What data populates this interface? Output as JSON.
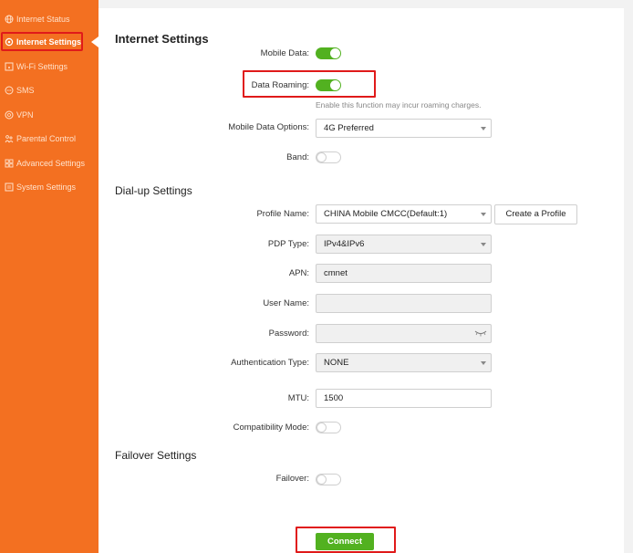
{
  "sidebar": {
    "items": [
      {
        "label": "Internet Status",
        "icon": "globe-icon"
      },
      {
        "label": "Internet Settings",
        "icon": "gear-icon"
      },
      {
        "label": "Wi-Fi Settings",
        "icon": "wifi-icon"
      },
      {
        "label": "SMS",
        "icon": "message-icon"
      },
      {
        "label": "VPN",
        "icon": "vpn-icon"
      },
      {
        "label": "Parental Control",
        "icon": "family-icon"
      },
      {
        "label": "Advanced Settings",
        "icon": "grid-icon"
      },
      {
        "label": "System Settings",
        "icon": "system-icon"
      }
    ],
    "active_index": 1,
    "accent_color": "#f37021"
  },
  "internet_settings": {
    "title": "Internet Settings",
    "mobile_data": {
      "label": "Mobile Data:",
      "on": true
    },
    "data_roaming": {
      "label": "Data Roaming:",
      "on": true,
      "hint": "Enable this function may incur roaming charges."
    },
    "mobile_data_options": {
      "label": "Mobile Data Options:",
      "value": "4G Preferred"
    },
    "band": {
      "label": "Band:",
      "on": false
    }
  },
  "dialup": {
    "title": "Dial-up Settings",
    "profile_name": {
      "label": "Profile Name:",
      "value": "CHINA Mobile CMCC(Default:1)",
      "create_label": "Create a Profile"
    },
    "pdp_type": {
      "label": "PDP Type:",
      "value": "IPv4&IPv6"
    },
    "apn": {
      "label": "APN:",
      "value": "cmnet"
    },
    "user_name": {
      "label": "User Name:",
      "value": ""
    },
    "password": {
      "label": "Password:",
      "value": ""
    },
    "auth_type": {
      "label": "Authentication Type:",
      "value": "NONE"
    },
    "mtu": {
      "label": "MTU:",
      "value": "1500"
    },
    "compat_mode": {
      "label": "Compatibility Mode:",
      "on": false
    }
  },
  "failover": {
    "title": "Failover Settings",
    "failover": {
      "label": "Failover:",
      "on": false
    }
  },
  "connect_label": "Connect",
  "colors": {
    "toggle_on": "#52b120",
    "annotation": "#e01a1a"
  }
}
